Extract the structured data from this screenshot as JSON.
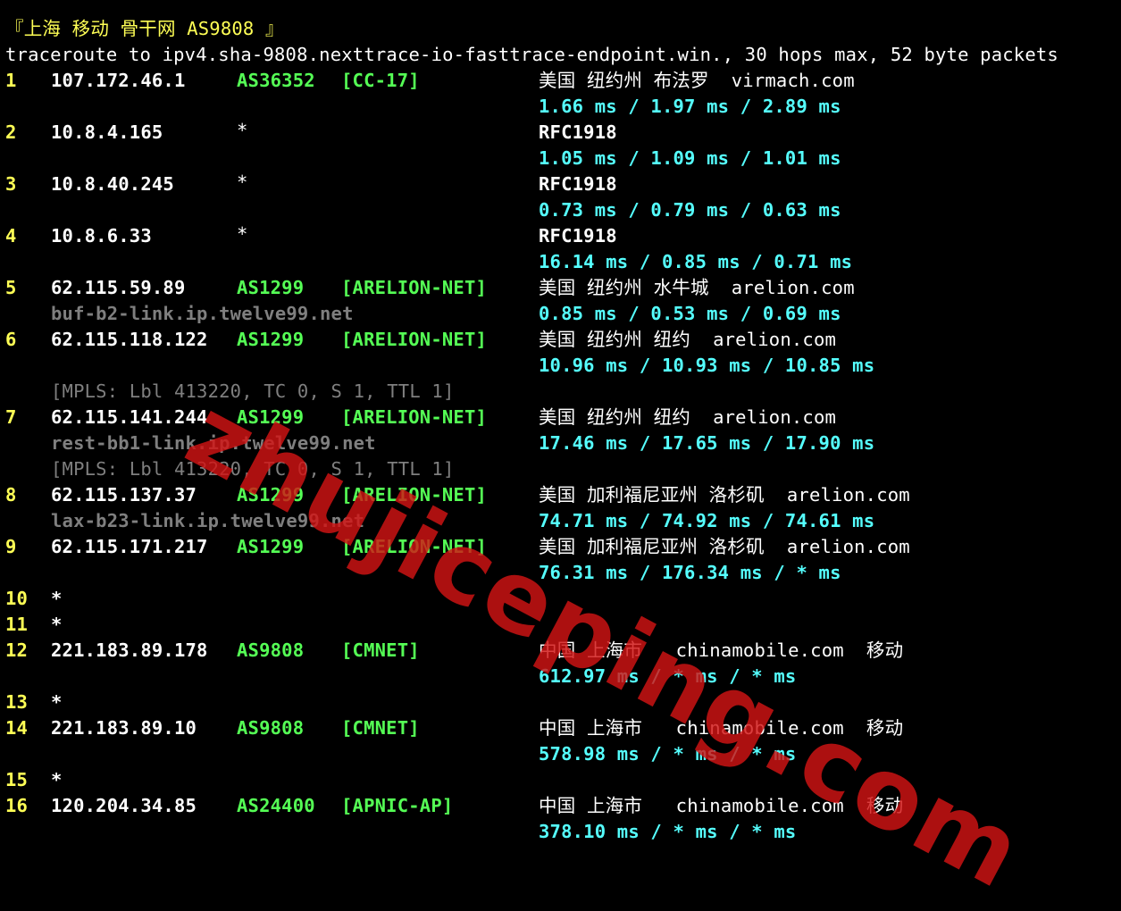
{
  "header": {
    "title": "『上海 移动 骨干网 AS9808 』"
  },
  "command": "traceroute to ipv4.sha-9808.nexttrace-io-fasttrace-endpoint.win., 30 hops max, 52 byte packets",
  "hops": [
    {
      "n": "1",
      "ip": "107.172.46.1",
      "as": "AS36352",
      "tag": "[CC-17]",
      "geo": "美国 纽约州 布法罗  virmach.com",
      "rtt": "1.66 ms / 1.97 ms / 2.89 ms"
    },
    {
      "n": "2",
      "ip": "10.8.4.165",
      "as": "*",
      "tag": "",
      "geo": "RFC1918",
      "rtt": "1.05 ms / 1.09 ms / 1.01 ms"
    },
    {
      "n": "3",
      "ip": "10.8.40.245",
      "as": "*",
      "tag": "",
      "geo": "RFC1918",
      "rtt": "0.73 ms / 0.79 ms / 0.63 ms"
    },
    {
      "n": "4",
      "ip": "10.8.6.33",
      "as": "*",
      "tag": "",
      "geo": "RFC1918",
      "rtt": "16.14 ms / 0.85 ms / 0.71 ms"
    },
    {
      "n": "5",
      "ip": "62.115.59.89",
      "as": "AS1299",
      "tag": "[ARELION-NET]",
      "geo": "美国 纽约州 水牛城  arelion.com",
      "rtt": "0.85 ms / 0.53 ms / 0.69 ms",
      "host": "buf-b2-link.ip.twelve99.net"
    },
    {
      "n": "6",
      "ip": "62.115.118.122",
      "as": "AS1299",
      "tag": "[ARELION-NET]",
      "geo": "美国 纽约州 纽约  arelion.com",
      "rtt": "10.96 ms / 10.93 ms / 10.85 ms",
      "mpls": "[MPLS: Lbl 413220, TC 0, S 1, TTL 1]"
    },
    {
      "n": "7",
      "ip": "62.115.141.244",
      "as": "AS1299",
      "tag": "[ARELION-NET]",
      "geo": "美国 纽约州 纽约  arelion.com",
      "rtt": "17.46 ms / 17.65 ms / 17.90 ms",
      "host": "rest-bb1-link.ip.twelve99.net",
      "mpls": "[MPLS: Lbl 413220, TC 0, S 1, TTL 1]"
    },
    {
      "n": "8",
      "ip": "62.115.137.37",
      "as": "AS1299",
      "tag": "[ARELION-NET]",
      "geo": "美国 加利福尼亚州 洛杉矶  arelion.com",
      "rtt": "74.71 ms / 74.92 ms / 74.61 ms",
      "host": "lax-b23-link.ip.twelve99.net"
    },
    {
      "n": "9",
      "ip": "62.115.171.217",
      "as": "AS1299",
      "tag": "[ARELION-NET]",
      "geo": "美国 加利福尼亚州 洛杉矶  arelion.com",
      "rtt": "76.31 ms / 176.34 ms / * ms"
    },
    {
      "n": "10",
      "ip": "*"
    },
    {
      "n": "11",
      "ip": "*"
    },
    {
      "n": "12",
      "ip": "221.183.89.178",
      "as": "AS9808",
      "tag": "[CMNET]",
      "geo": "中国 上海市   chinamobile.com  移动",
      "rtt": "612.97 ms / * ms / * ms"
    },
    {
      "n": "13",
      "ip": "*"
    },
    {
      "n": "14",
      "ip": "221.183.89.10",
      "as": "AS9808",
      "tag": "[CMNET]",
      "geo": "中国 上海市   chinamobile.com  移动",
      "rtt": "578.98 ms / * ms / * ms"
    },
    {
      "n": "15",
      "ip": "*"
    },
    {
      "n": "16",
      "ip": "120.204.34.85",
      "as": "AS24400",
      "tag": "[APNIC-AP]",
      "geo": "中国 上海市   chinamobile.com  移动",
      "rtt": "378.10 ms / * ms / * ms"
    }
  ],
  "watermark": "zhujiceping.com"
}
